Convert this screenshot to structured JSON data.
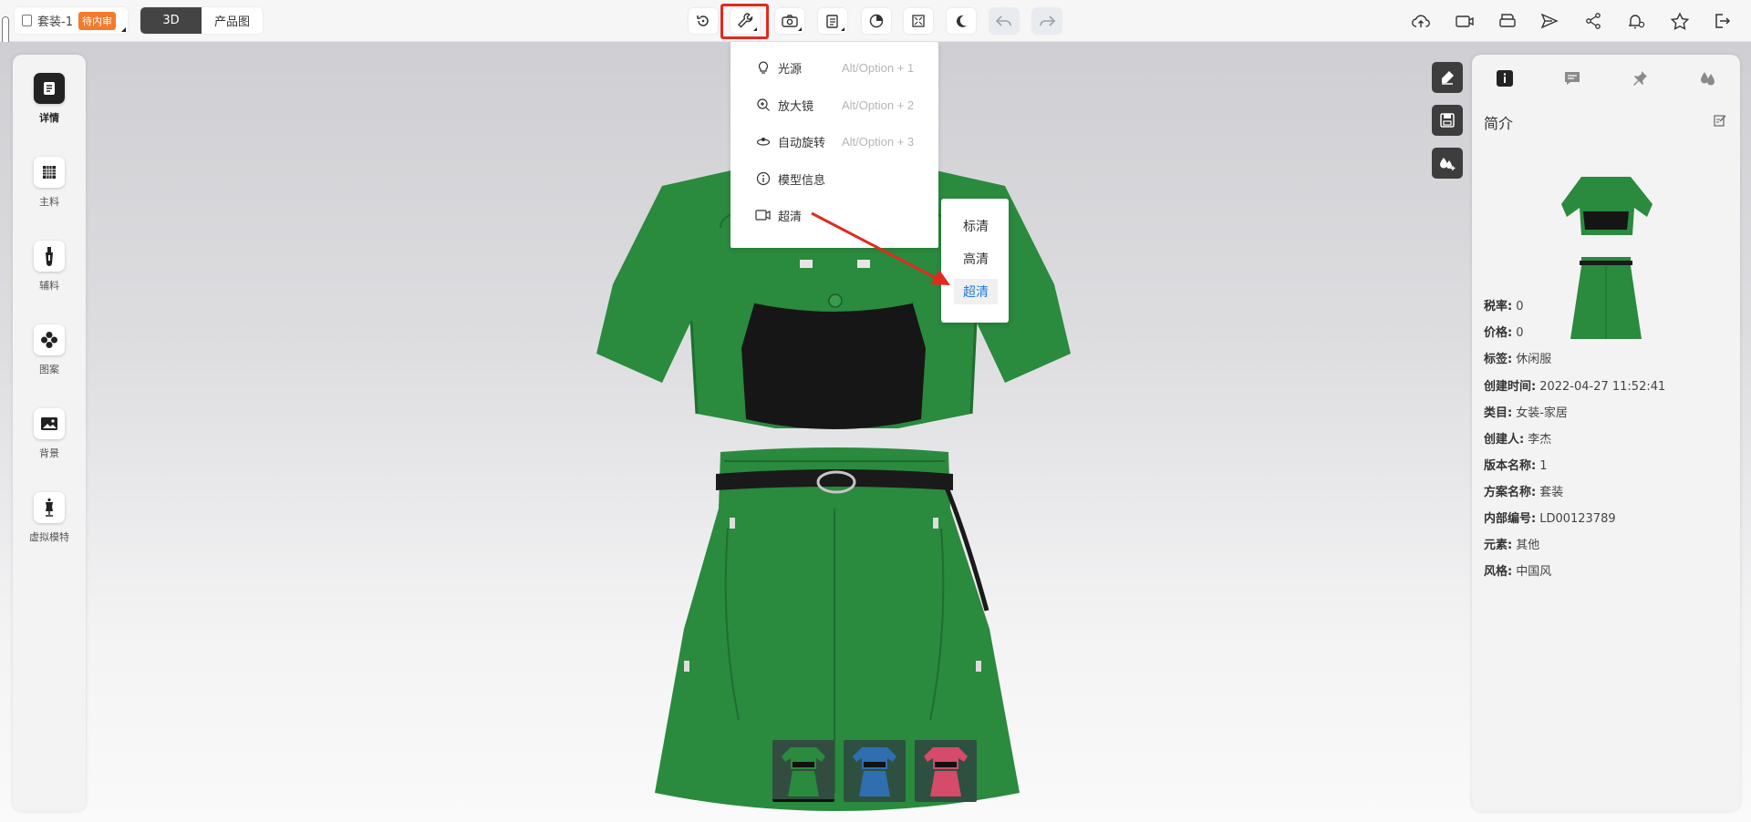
{
  "toolbar": {
    "file_name": "套装-1",
    "status_badge": "待内审",
    "view_tabs": [
      "3D",
      "产品图"
    ],
    "active_view": "3D"
  },
  "tool_menu": {
    "items": [
      {
        "icon": "lightbulb-icon",
        "label": "光源",
        "shortcut": "Alt/Option + 1"
      },
      {
        "icon": "magnifier-icon",
        "label": "放大镜",
        "shortcut": "Alt/Option + 2"
      },
      {
        "icon": "auto-rotate-icon",
        "label": "自动旋转",
        "shortcut": "Alt/Option + 3"
      },
      {
        "icon": "info-circle-icon",
        "label": "模型信息",
        "shortcut": ""
      },
      {
        "icon": "video-camera-icon",
        "label": "超清",
        "shortcut": ""
      }
    ]
  },
  "quality_submenu": {
    "options": [
      "标清",
      "高清",
      "超清"
    ],
    "selected": "超清",
    "selected_color": "#1f7ae0"
  },
  "left_sidebar": {
    "items": [
      {
        "icon": "details-icon",
        "label": "详情",
        "selected": true
      },
      {
        "icon": "fabric-grid-icon",
        "label": "主料",
        "selected": false
      },
      {
        "icon": "zipper-icon",
        "label": "辅料",
        "selected": false
      },
      {
        "icon": "pattern-icon",
        "label": "图案",
        "selected": false
      },
      {
        "icon": "background-image-icon",
        "label": "背景",
        "selected": false
      },
      {
        "icon": "mannequin-icon",
        "label": "虚拟模特",
        "selected": false
      }
    ]
  },
  "right_panel": {
    "title": "简介",
    "info": [
      {
        "key": "税率:",
        "value": "0"
      },
      {
        "key": "价格:",
        "value": "0"
      },
      {
        "key": "标签:",
        "value": "休闲服"
      },
      {
        "key": "创建时间:",
        "value": "2022-04-27 11:52:41"
      },
      {
        "key": "类目:",
        "value": "女装-家居"
      },
      {
        "key": "创建人:",
        "value": "李杰"
      },
      {
        "key": "版本名称:",
        "value": "1"
      },
      {
        "key": "方案名称:",
        "value": "套装"
      },
      {
        "key": "内部编号:",
        "value": "LD00123789"
      },
      {
        "key": "元素:",
        "value": "其他"
      },
      {
        "key": "风格:",
        "value": "中国风"
      }
    ]
  },
  "colors": {
    "garment_green": "#2a8a3e",
    "variant_blue": "#2f6fb0",
    "variant_pink": "#d64a6a",
    "accent_red": "#e12a1f",
    "badge_orange": "#f47a2c"
  },
  "variants": [
    "green",
    "blue",
    "pink"
  ],
  "selected_variant": "green"
}
